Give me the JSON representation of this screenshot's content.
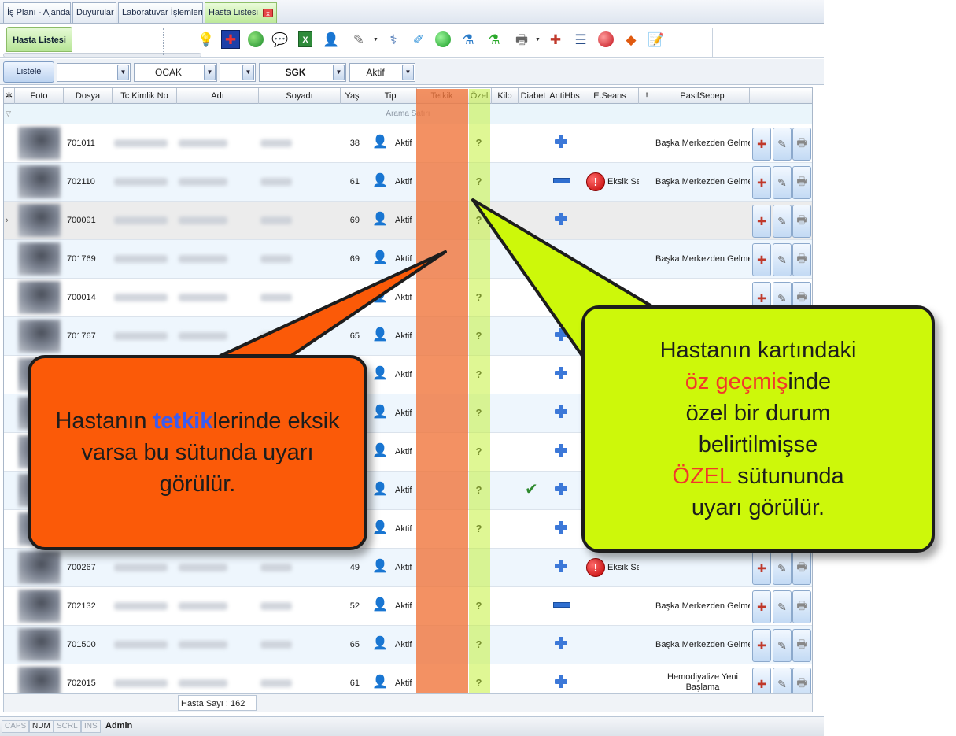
{
  "tabs": [
    {
      "label": "İş Planı - Ajanda"
    },
    {
      "label": "Duyurular"
    },
    {
      "label": "Laboratuvar İşlemleri"
    },
    {
      "label": "Hasta Listesi",
      "close": "x"
    }
  ],
  "ribbon": {
    "tab_label": "Hasta Listesi"
  },
  "filters": {
    "listele_label": "Listele",
    "combo1": "",
    "month": "OCAK",
    "combo3": "",
    "insurance": "SGK",
    "status": "Aktif"
  },
  "columns": [
    "Foto",
    "Dosya",
    "Tc Kimlik No",
    "Adı",
    "Soyadı",
    "Yaş",
    "Tip",
    "Tetkik",
    "Özel",
    "Kilo",
    "Diabet",
    "AntiHbs",
    "E.Seans",
    "!",
    "PasifSebep"
  ],
  "search_row": "Arama Satırı",
  "rows": [
    {
      "dosya": "701011",
      "yas": "38",
      "tip": "Aktif",
      "ozel": "?",
      "diabet": "",
      "antihbs": "plus",
      "eseans": "",
      "pasif": "Başka Merkezden Gelme"
    },
    {
      "dosya": "702110",
      "yas": "61",
      "tip": "Aktif",
      "ozel": "?",
      "diabet": "",
      "antihbs": "minus",
      "eseans": "Eksik Se",
      "pasif": "Başka Merkezden Gelme"
    },
    {
      "dosya": "700091",
      "yas": "69",
      "tip": "Aktif",
      "ozel": "?",
      "diabet": "",
      "antihbs": "plus",
      "eseans": "",
      "pasif": ""
    },
    {
      "dosya": "701769",
      "yas": "69",
      "tip": "Aktif",
      "ozel": "",
      "diabet": "",
      "antihbs": "plus",
      "eseans": "",
      "pasif": "Başka Merkezden Gelme"
    },
    {
      "dosya": "700014",
      "yas": "",
      "tip": "Aktif",
      "ozel": "?",
      "diabet": "",
      "antihbs": "plus",
      "eseans": "",
      "pasif": ""
    },
    {
      "dosya": "701767",
      "yas": "65",
      "tip": "Aktif",
      "ozel": "?",
      "diabet": "",
      "antihbs": "plus",
      "eseans": "",
      "pasif": ""
    },
    {
      "dosya": "",
      "yas": "",
      "tip": "Aktif",
      "ozel": "?",
      "diabet": "",
      "antihbs": "plus",
      "eseans": "",
      "pasif": ""
    },
    {
      "dosya": "",
      "yas": "",
      "tip": "Aktif",
      "ozel": "?",
      "diabet": "",
      "antihbs": "plus",
      "eseans": "",
      "pasif": ""
    },
    {
      "dosya": "",
      "yas": "",
      "tip": "Aktif",
      "ozel": "?",
      "diabet": "",
      "antihbs": "plus",
      "eseans": "",
      "pasif": ""
    },
    {
      "dosya": "",
      "yas": "",
      "tip": "Aktif",
      "ozel": "?",
      "diabet": "check",
      "antihbs": "plus",
      "eseans": "",
      "pasif": ""
    },
    {
      "dosya": "",
      "yas": "",
      "tip": "Aktif",
      "ozel": "?",
      "diabet": "",
      "antihbs": "plus",
      "eseans": "",
      "pasif": ""
    },
    {
      "dosya": "700267",
      "yas": "49",
      "tip": "Aktif",
      "ozel": "",
      "diabet": "",
      "antihbs": "plus",
      "eseans": "Eksik Se",
      "pasif": ""
    },
    {
      "dosya": "702132",
      "yas": "52",
      "tip": "Aktif",
      "ozel": "?",
      "diabet": "",
      "antihbs": "minus",
      "eseans": "",
      "pasif": "Başka Merkezden Gelme"
    },
    {
      "dosya": "701500",
      "yas": "65",
      "tip": "Aktif",
      "ozel": "?",
      "diabet": "",
      "antihbs": "plus",
      "eseans": "",
      "pasif": "Başka Merkezden Gelme"
    },
    {
      "dosya": "702015",
      "yas": "61",
      "tip": "Aktif",
      "ozel": "?",
      "diabet": "",
      "antihbs": "plus",
      "eseans": "",
      "pasif": "Hemodiyalize Yeni Başlama"
    }
  ],
  "footer": {
    "count": "Hasta Sayı : 162"
  },
  "status": {
    "caps": "CAPS",
    "num": "NUM",
    "scrl": "SCRL",
    "ins": "INS",
    "user": "Admin"
  },
  "callouts": {
    "left": {
      "before": "Hastanın ",
      "highlight": "tetkik",
      "after": "lerinde eksik varsa bu sütunda uyarı görülür."
    },
    "right": {
      "line1": "Hastanın kartındaki",
      "hl1": "öz geçmiş",
      "line2a": "inde",
      "line3": "özel bir durum",
      "line4": "belirtilmişse",
      "hl2": "ÖZEL",
      "line5a": " sütununda",
      "line6": "uyarı görülür."
    }
  },
  "colors": {
    "tetkik_highlight": "#f0763c",
    "ozel_highlight": "#c4f03c",
    "callout_left": "#fb5a08",
    "callout_right": "#cdf80a",
    "callout_left_accent": "#3b5cf0",
    "callout_right_accent": "#f2382a"
  },
  "icons": [
    "lightbulb-icon",
    "heart-monitor-icon",
    "globe-icon",
    "chat-icon",
    "excel-icon",
    "user-add-icon",
    "pen-icon",
    "doctor-icon",
    "syringe-icon",
    "green-ball-icon",
    "flask-icon",
    "lab-flask-icon",
    "printer-icon",
    "medical-bag-icon",
    "checklist-icon",
    "red-ball-icon",
    "eraser-icon",
    "edit-doc-icon"
  ]
}
